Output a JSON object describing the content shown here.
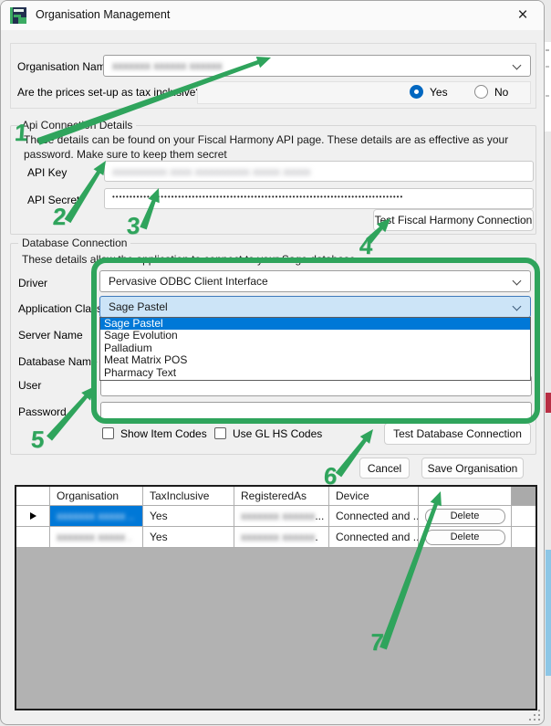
{
  "window": {
    "title": "Organisation Management",
    "close_glyph": "×"
  },
  "top": {
    "org_label": "Organisation Name",
    "org_value_blurred": "xxxxxxx xxxxxx xxxxxx",
    "tax_question": "Are the prices set-up as tax inclusive?",
    "yes_label": "Yes",
    "no_label": "No"
  },
  "api": {
    "group_title": "Api Connection Details",
    "description": "These details can be found on your Fiscal Harmony API page. These details are as effective as your password. Make sure to keep them secret",
    "key_label": "API Key",
    "key_value_blurred": "xxxxxxxxxx xxxx xxxxxxxxxx xxxxx xxxxx",
    "secret_label": "API Secret",
    "secret_value": "••••••••••••••••••••••••••••••••••••••••••••••••••••••••••••••••••••••••••••••••••••",
    "test_button": "Test Fiscal Harmony Connection"
  },
  "db": {
    "group_title": "Database Connection",
    "description": "These details allow the application to connect to your Sage database",
    "driver_label": "Driver",
    "driver_value": "Pervasive ODBC Client Interface",
    "class_label": "Application Class",
    "class_value": "Sage Pastel",
    "options": [
      "Sage Pastel",
      "Sage Evolution",
      "Palladium",
      "Meat Matrix POS",
      "Pharmacy Text"
    ],
    "selected_option_index": 0,
    "server_label": "Server Name",
    "database_label": "Database Name",
    "user_label": "User",
    "password_label": "Password",
    "cb_show_item_codes": "Show Item Codes",
    "cb_use_gl_hs": "Use GL HS Codes",
    "test_button": "Test Database Connection"
  },
  "actions": {
    "cancel": "Cancel",
    "save": "Save Organisation"
  },
  "table": {
    "columns": [
      "Organisation",
      "TaxInclusive",
      "RegisteredAs",
      "Device"
    ],
    "rows": [
      {
        "organisation_blurred": "xxxxxxx xxxxx ..",
        "tax": "Yes",
        "registered_blurred": "xxxxxxx xxxxxx",
        "registered_suffix": "...",
        "device": "Connected and ...",
        "delete_label": "Delete"
      },
      {
        "organisation_blurred": "xxxxxxx xxxxx .",
        "tax": "Yes",
        "registered_blurred": "xxxxxxx xxxxxx",
        "registered_suffix": ".",
        "device": "Connected and ...",
        "delete_label": "Delete"
      }
    ]
  },
  "annotations": {
    "color": "#2fa45c",
    "labels": [
      "1",
      "2",
      "3",
      "4",
      "5",
      "6",
      "7"
    ]
  },
  "colors": {
    "selection": "#0078d7",
    "radio_accent": "#0067c0",
    "focused_combo_bg": "#cce4f7"
  }
}
